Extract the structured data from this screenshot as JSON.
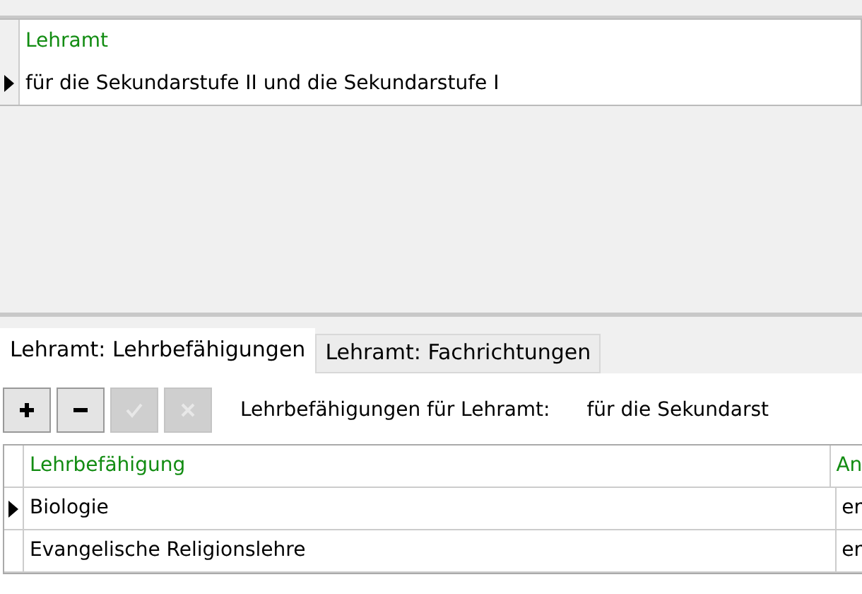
{
  "top_grid": {
    "columns": [
      "Lehramt"
    ],
    "rows": [
      {
        "cells": [
          "für die Sekundarstufe II und die Sekundarstufe I"
        ],
        "current": true
      }
    ]
  },
  "tabs": [
    {
      "label": "Lehramt: Lehrbefähigungen",
      "selected": true
    },
    {
      "label": "Lehramt: Fachrichtungen",
      "selected": false
    }
  ],
  "toolbar": {
    "buttons": [
      {
        "kind": "add",
        "disabled": false
      },
      {
        "kind": "remove",
        "disabled": false
      },
      {
        "kind": "confirm",
        "disabled": true
      },
      {
        "kind": "cancel",
        "disabled": true
      }
    ],
    "label": "Lehrbefähigungen für Lehramt:",
    "value": "für die Sekundarst"
  },
  "bottom_grid": {
    "columns": [
      "Lehrbefähigung",
      "An"
    ],
    "rows": [
      {
        "cells": [
          "Biologie",
          "er"
        ],
        "current": true
      },
      {
        "cells": [
          "Evangelische Religionslehre",
          "er"
        ],
        "current": false
      }
    ]
  }
}
